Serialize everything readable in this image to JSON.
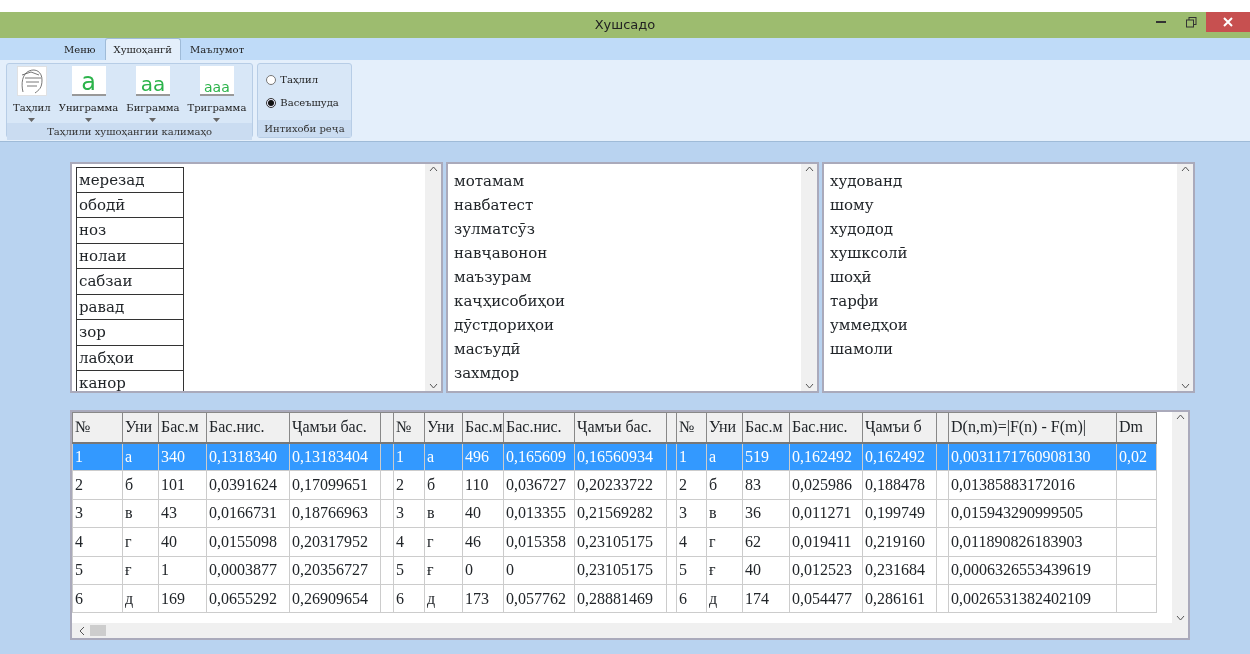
{
  "window": {
    "title": "Хушсадо"
  },
  "ribbon_tabs": [
    {
      "label": "Меню",
      "selected": false
    },
    {
      "label": "Хушоҳангӣ",
      "selected": true
    },
    {
      "label": "Маълумот",
      "selected": false
    }
  ],
  "ribbon_groups": [
    {
      "kind": "buttons",
      "label": "Таҳлили хушоҳангии калимаҳо",
      "buttons": [
        {
          "label": "Таҳлил",
          "kind": "sketch"
        },
        {
          "label": "Униграмма",
          "kind": "letters",
          "glyph": "a"
        },
        {
          "label": "Биграмма",
          "kind": "letters",
          "glyph": "aa"
        },
        {
          "label": "Триграмма",
          "kind": "letters",
          "glyph": "aaa"
        }
      ]
    },
    {
      "kind": "radios",
      "label": "Интихоби реҷа",
      "options": [
        {
          "label": "Таҳлил",
          "selected": false
        },
        {
          "label": "Васеъшуда",
          "selected": true
        }
      ]
    }
  ],
  "word_lists": [
    {
      "kind": "grid",
      "items": [
        "мерезад",
        "ободӣ",
        "ноз",
        "нолаи",
        "сабзаи",
        "равад",
        "зор",
        "лабҳои",
        "канор"
      ]
    },
    {
      "kind": "plain",
      "items": [
        "мотамам",
        "навбатест",
        "зулматсӯз",
        "навҷавонон",
        "маъзурам",
        "каҷҳисобиҳои",
        "дӯстдориҳои",
        "масъудӣ",
        "захмдор"
      ]
    },
    {
      "kind": "plain",
      "items": [
        "худованд",
        "шому",
        "худодод",
        "хушксолӣ",
        "шоҳӣ",
        "тарфи",
        "уммедҳои",
        "шамоли"
      ]
    }
  ],
  "table": {
    "column_groups": [
      {
        "kind": "block",
        "columns": [
          "№",
          "Уни",
          "Бас.м",
          "Бас.нис.",
          "Ҷамъи бас."
        ]
      },
      {
        "kind": "block",
        "columns": [
          "№",
          "Уни",
          "Бас.м",
          "Бас.нис.",
          "Ҷамъи бас."
        ]
      },
      {
        "kind": "block",
        "columns": [
          "№",
          "Уни",
          "Бас.м",
          "Бас.нис.",
          "Ҷамъи б"
        ]
      },
      {
        "kind": "tail",
        "columns": [
          "D(n,m)=|F(n) - F(m)|",
          "Dm"
        ]
      }
    ],
    "rows": [
      {
        "selected": true,
        "groups": [
          [
            "1",
            "а",
            "340",
            "0,1318340",
            "0,13183404"
          ],
          [
            "1",
            "а",
            "496",
            "0,165609",
            "0,16560934"
          ],
          [
            "1",
            "а",
            "519",
            "0,162492",
            "0,162492"
          ],
          [
            "0,0031171760908130",
            "0,02"
          ]
        ]
      },
      {
        "selected": false,
        "groups": [
          [
            "2",
            "б",
            "101",
            "0,0391624",
            "0,17099651"
          ],
          [
            "2",
            "б",
            "110",
            "0,036727",
            "0,20233722"
          ],
          [
            "2",
            "б",
            "83",
            "0,025986",
            "0,188478"
          ],
          [
            "0,01385883172016"
          ]
        ]
      },
      {
        "selected": false,
        "groups": [
          [
            "3",
            "в",
            "43",
            "0,0166731",
            "0,18766963"
          ],
          [
            "3",
            "в",
            "40",
            "0,013355",
            "0,21569282"
          ],
          [
            "3",
            "в",
            "36",
            "0,011271",
            "0,199749"
          ],
          [
            "0,015943290999505"
          ]
        ]
      },
      {
        "selected": false,
        "groups": [
          [
            "4",
            "г",
            "40",
            "0,0155098",
            "0,20317952"
          ],
          [
            "4",
            "г",
            "46",
            "0,015358",
            "0,23105175"
          ],
          [
            "4",
            "г",
            "62",
            "0,019411",
            "0,219160"
          ],
          [
            "0,011890826183903"
          ]
        ]
      },
      {
        "selected": false,
        "groups": [
          [
            "5",
            "ғ",
            "1",
            "0,0003877",
            "0,20356727"
          ],
          [
            "5",
            "ғ",
            "0",
            "0",
            "0,23105175"
          ],
          [
            "5",
            "ғ",
            "40",
            "0,012523",
            "0,231684"
          ],
          [
            "0,0006326553439619"
          ]
        ]
      },
      {
        "selected": false,
        "groups": [
          [
            "6",
            "д",
            "169",
            "0,0655292",
            "0,26909654"
          ],
          [
            "6",
            "д",
            "173",
            "0,057762",
            "0,28881469"
          ],
          [
            "6",
            "д",
            "174",
            "0,054477",
            "0,286161"
          ],
          [
            "0,0026531382402109"
          ]
        ]
      }
    ]
  }
}
